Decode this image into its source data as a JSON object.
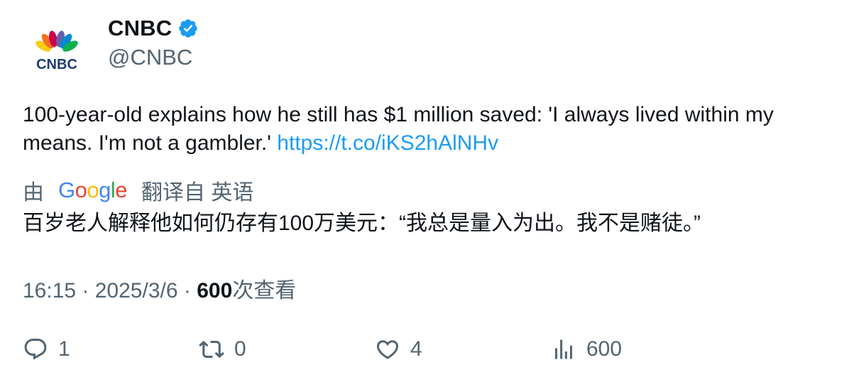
{
  "author": {
    "display_name": "CNBC",
    "handle": "@CNBC",
    "verified": true,
    "avatar_icon": "cnbc-peacock-logo",
    "avatar_text": "CNBC"
  },
  "tweet": {
    "text": "100-year-old explains how he still has $1 million saved: 'I always lived within my means. I'm not a gambler.' ",
    "link": "https://t.co/iKS2hAlNHv"
  },
  "translation": {
    "prefix": "由",
    "provider": "Google",
    "suffix": "翻译自 英语",
    "text": "百岁老人解释他如何仍存有100万美元：“我总是量入为出。我不是赌徒。”"
  },
  "meta": {
    "time": "16:15",
    "separator": " · ",
    "date": "2025/3/6",
    "views_count": "600",
    "views_label": "次查看"
  },
  "actions": {
    "reply_count": "1",
    "retweet_count": "0",
    "like_count": "4",
    "views_count": "600"
  },
  "colors": {
    "link": "#1d9bf0",
    "secondary_text": "#536471",
    "verified_badge": "#1d9bf0"
  }
}
